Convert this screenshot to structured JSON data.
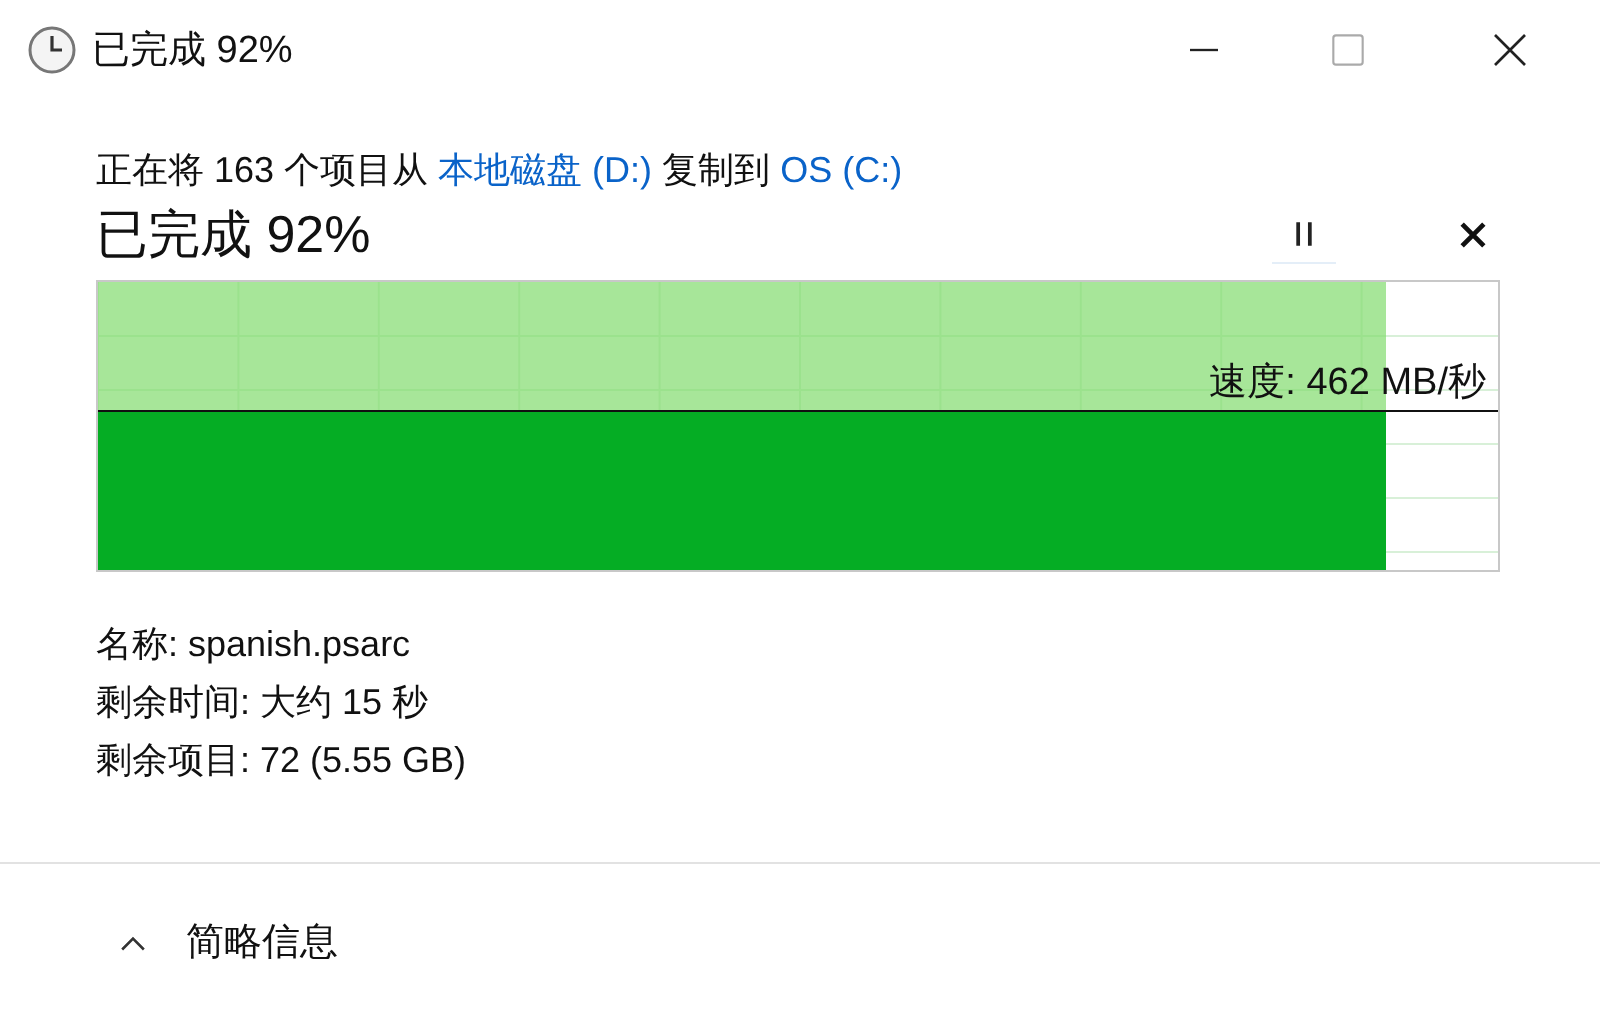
{
  "window": {
    "title": "已完成 92%"
  },
  "description": [
    {
      "kind": "text",
      "text": "正在将 163 个项目从 "
    },
    {
      "kind": "link",
      "text": "本地磁盘 (D:)"
    },
    {
      "kind": "text",
      "text": " 复制到 "
    },
    {
      "kind": "link",
      "text": "OS (C:)"
    }
  ],
  "progress": {
    "heading": "已完成 92%",
    "level": 0.92,
    "speed": "速度: 462 MB/秒"
  },
  "details": [
    {
      "label": "名称:",
      "value": "spanish.psarc"
    },
    {
      "label": "剩余时间:",
      "value": "大约 15 秒"
    },
    {
      "label": "剩余项目:",
      "value": "72 (5.55 GB)"
    }
  ],
  "footer": {
    "toggle": "简略信息"
  }
}
